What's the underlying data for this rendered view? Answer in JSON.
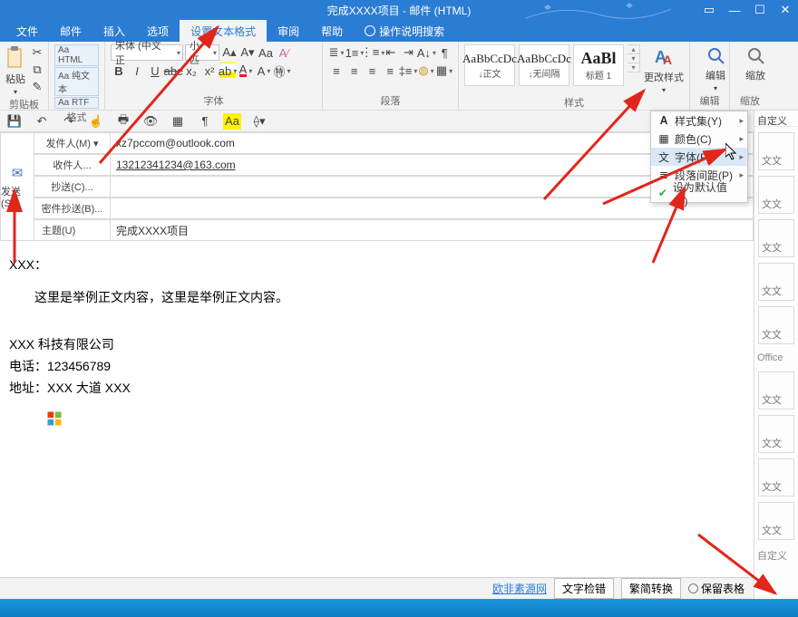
{
  "window": {
    "title": "完成XXXX项目 - 邮件 (HTML)"
  },
  "tabs": {
    "file": "文件",
    "mail": "邮件",
    "insert": "插入",
    "options": "选项",
    "format": "设置文本格式",
    "review": "审阅",
    "help": "帮助",
    "tell": "操作说明搜索"
  },
  "ribbon": {
    "clipboard": {
      "label": "剪贴板",
      "paste": "粘贴"
    },
    "format": {
      "label": "格式",
      "html": "Aa HTML",
      "plain": "Aa 纯文本",
      "rtf": "Aa RTF"
    },
    "font": {
      "label": "字体",
      "family": "宋体 (中文正",
      "size": "小匹"
    },
    "paragraph": {
      "label": "段落"
    },
    "styles": {
      "label": "样式",
      "s1_prev": "AaBbCcDc",
      "s1_name": "↓正文",
      "s2_prev": "AaBbCcDc",
      "s2_name": "↓无间隔",
      "s3_prev": "AaBl",
      "s3_name": "标题 1",
      "change": "更改样式"
    },
    "edit": {
      "label": "编辑",
      "btn": "编辑"
    },
    "zoom": {
      "label": "缩放",
      "btn": "缩放"
    }
  },
  "menu": {
    "styleset": "样式集(Y)",
    "color": "颜色(C)",
    "font": "字体(F)",
    "spacing": "段落间距(P)",
    "default": "设为默认值(D)"
  },
  "side": {
    "head": "自定义",
    "office": "Office",
    "foot": "自定义",
    "item": "文文"
  },
  "compose": {
    "send": "发送(S)",
    "from_btn": "发件人(M) ▾",
    "from_val": "xz7pccom@outlook.com",
    "to_btn": "收件人...",
    "to_val": "13212341234@163.com",
    "cc_btn": "抄送(C)...",
    "cc_val": "",
    "bcc_btn": "密件抄送(B)...",
    "bcc_val": "",
    "subj_lbl": "主题(U)",
    "subj_val": "完成XXXX项目"
  },
  "body": {
    "greet": "XXX：",
    "para": "这里是举例正文内容，这里是举例正文内容。",
    "sig1": "XXX 科技有限公司",
    "sig2": "电话：123456789",
    "sig3": "地址：XXX 大道 XXX"
  },
  "bottom": {
    "link": "欧非素源网",
    "check": "文字检错",
    "trad": "繁简转换",
    "keep": "保留表格"
  }
}
